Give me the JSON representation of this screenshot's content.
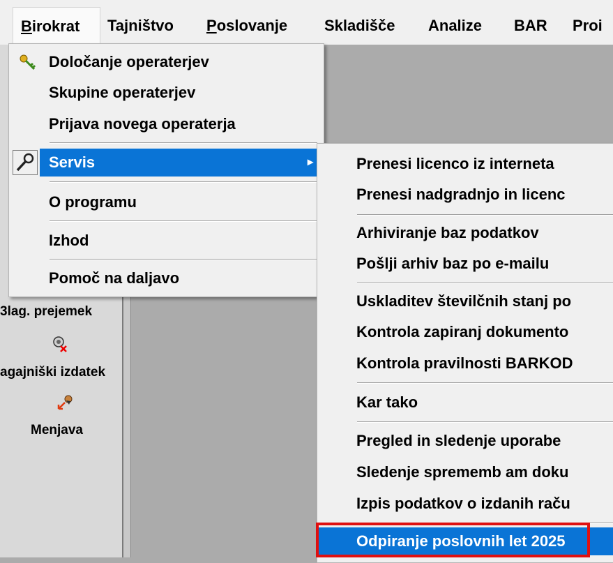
{
  "menubar": {
    "items": [
      {
        "label": "Birokrat",
        "open": true
      },
      {
        "label": "Tajništvo"
      },
      {
        "label": "Poslovanje"
      },
      {
        "label": "Skladišče"
      },
      {
        "label": "Analize"
      },
      {
        "label": "BAR"
      },
      {
        "label": "Proi"
      }
    ]
  },
  "main_menu": {
    "items": [
      {
        "label": "Določanje operaterjev",
        "icon": "key-icon"
      },
      {
        "label": "Skupine operaterjev"
      },
      {
        "label": "Prijava novega operaterja"
      },
      {
        "label": "Servis",
        "icon": "wrench-icon",
        "submenu_arrow": "▸",
        "highlighted": true
      },
      {
        "label": "O programu"
      },
      {
        "label": "Izhod"
      },
      {
        "label": "Pomoč na daljavo"
      }
    ]
  },
  "sub_menu": {
    "items": [
      {
        "label": "Prenesi licenco iz interneta"
      },
      {
        "label": "Prenesi nadgradnjo in licenc"
      },
      {
        "label": "Arhiviranje baz podatkov"
      },
      {
        "label": "Pošlji arhiv baz po e-mailu"
      },
      {
        "label": "Uskladitev številčnih stanj po"
      },
      {
        "label": "Kontrola zapiranj dokumento"
      },
      {
        "label": "Kontrola pravilnosti BARKOD"
      },
      {
        "label": "Kar tako"
      },
      {
        "label": "Pregled in sledenje uporabe"
      },
      {
        "label": "Sledenje sprememb am doku"
      },
      {
        "label": "Izpis podatkov o izdanih raču"
      },
      {
        "label": "Odpiranje poslovnih let 2025",
        "highlighted": true
      }
    ]
  },
  "left_panel": {
    "items": [
      {
        "label": "3lag. prejemek"
      },
      {
        "label": "agajniški izdatek",
        "icon": "cash-expense-icon"
      },
      {
        "label": "Menjava",
        "icon": "exchange-icon"
      }
    ]
  },
  "colors": {
    "highlight": "#0a74d6",
    "annotation_box": "#e01010",
    "menu_bg": "#f0f0f0",
    "workspace_bg": "#ababab"
  }
}
